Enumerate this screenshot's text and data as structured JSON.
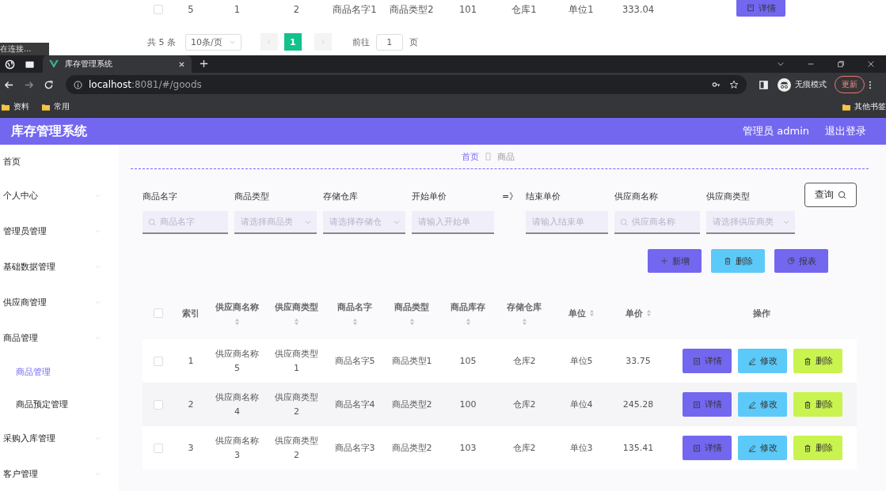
{
  "background_page": {
    "row": {
      "checked": false,
      "cells": [
        "5",
        "1",
        "2",
        "商品名字1",
        "商品类型2",
        "101",
        "仓库1",
        "单位1",
        "333.04"
      ],
      "action": "详情"
    },
    "pagination": {
      "total": "共 5 条",
      "page_size": "10条/页",
      "pages": [
        {
          "label": "1",
          "selected": true
        }
      ],
      "goto_label": "前往",
      "goto_value": "1",
      "goto_suffix": "页"
    }
  },
  "status_tooltip": "在连接...",
  "browser": {
    "tabs": [
      {
        "title": "库存管理系统",
        "selected": true
      }
    ],
    "url_host": "localhost",
    "url_rest": ":8081/#/goods",
    "profile": "无痕模式",
    "update": "更新",
    "bookmarks": [
      "资料",
      "常用"
    ],
    "other_bookmarks": "其他书签"
  },
  "app": {
    "title": "库存管理系统",
    "user": "管理员 admin",
    "logout": "退出登录",
    "sidebar": [
      {
        "label": "首页",
        "kind": "link"
      },
      {
        "label": "个人中心",
        "kind": "menu",
        "expanded": false
      },
      {
        "label": "管理员管理",
        "kind": "menu",
        "expanded": false
      },
      {
        "label": "基础数据管理",
        "kind": "menu",
        "expanded": false
      },
      {
        "label": "供应商管理",
        "kind": "menu",
        "expanded": false
      },
      {
        "label": "商品管理",
        "kind": "menu",
        "expanded": true,
        "children": [
          {
            "label": "商品管理",
            "selected": true
          },
          {
            "label": "商品预定管理",
            "selected": false
          }
        ]
      },
      {
        "label": "采购入库管理",
        "kind": "menu",
        "expanded": false
      },
      {
        "label": "客户管理",
        "kind": "menu",
        "expanded": false
      }
    ],
    "breadcrumb": [
      "首页",
      "商品"
    ],
    "filters": [
      {
        "kind": "search",
        "label": "商品名字",
        "placeholder": "商品名字"
      },
      {
        "kind": "select",
        "label": "商品类型",
        "placeholder": "请选择商品类"
      },
      {
        "kind": "select",
        "label": "存储仓库",
        "placeholder": "请选择存储仓"
      },
      {
        "kind": "input",
        "label": "开始单价",
        "placeholder": "请输入开始单"
      },
      {
        "kind": "separator",
        "label": "=》"
      },
      {
        "kind": "input",
        "label": "结束单价",
        "placeholder": "请输入结束单"
      },
      {
        "kind": "search",
        "label": "供应商名称",
        "placeholder": "供应商名称"
      },
      {
        "kind": "select",
        "label": "供应商类型",
        "placeholder": "请选择供应商类"
      }
    ],
    "query_button": "查询",
    "toolbar": [
      {
        "label": "新增",
        "kind": "add"
      },
      {
        "label": "删除",
        "kind": "delete"
      },
      {
        "label": "报表",
        "kind": "report"
      }
    ],
    "table": {
      "header_checked": false,
      "columns": [
        {
          "label": "索引",
          "sortable": false
        },
        {
          "label": "供应商名称",
          "sortable": true
        },
        {
          "label": "供应商类型",
          "sortable": true
        },
        {
          "label": "商品名字",
          "sortable": true
        },
        {
          "label": "商品类型",
          "sortable": true
        },
        {
          "label": "商品库存",
          "sortable": true
        },
        {
          "label": "存储仓库",
          "sortable": true
        },
        {
          "label": "单位",
          "sortable": true
        },
        {
          "label": "单价",
          "sortable": true
        },
        {
          "label": "操作",
          "sortable": false
        }
      ],
      "rows": [
        {
          "checked": false,
          "cells": [
            "1",
            "供应商名称5",
            "供应商类型1",
            "商品名字5",
            "商品类型1",
            "105",
            "仓库2",
            "单位5",
            "33.75"
          ],
          "actions": [
            {
              "label": "详情",
              "kind": "detail"
            },
            {
              "label": "修改",
              "kind": "edit"
            },
            {
              "label": "删除",
              "kind": "delete"
            }
          ]
        },
        {
          "checked": false,
          "cells": [
            "2",
            "供应商名称4",
            "供应商类型2",
            "商品名字4",
            "商品类型2",
            "100",
            "仓库2",
            "单位4",
            "245.28"
          ],
          "actions": [
            {
              "label": "详情",
              "kind": "detail"
            },
            {
              "label": "修改",
              "kind": "edit"
            },
            {
              "label": "删除",
              "kind": "delete"
            }
          ]
        },
        {
          "checked": false,
          "cells": [
            "3",
            "供应商名称3",
            "供应商类型2",
            "商品名字3",
            "商品类型2",
            "103",
            "仓库2",
            "单位3",
            "135.41"
          ],
          "actions": [
            {
              "label": "详情",
              "kind": "detail"
            },
            {
              "label": "修改",
              "kind": "edit"
            },
            {
              "label": "删除",
              "kind": "delete"
            }
          ]
        }
      ]
    }
  }
}
